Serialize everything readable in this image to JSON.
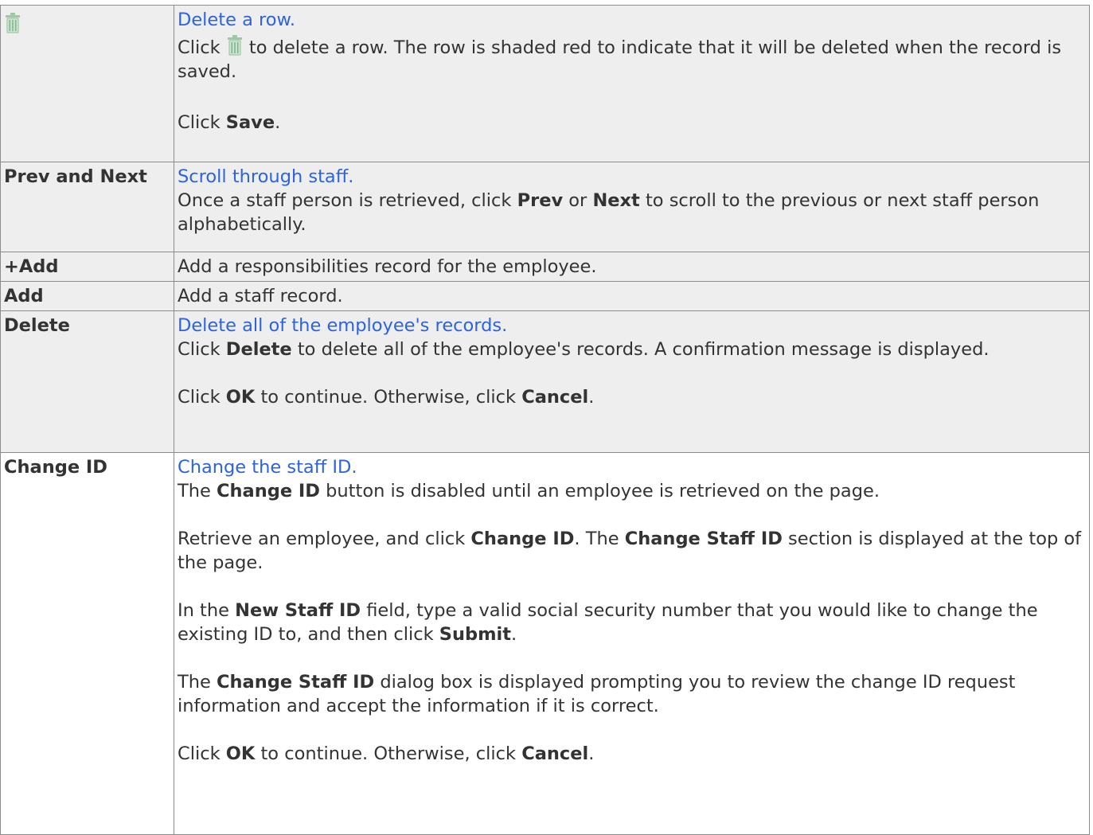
{
  "rows": [
    {
      "key_icon": "trash-icon",
      "heading": "Delete a row.",
      "p1": {
        "a": "Click ",
        "icon": "trash-icon",
        "b": " to delete a row. The row is shaded red to indicate that it will be deleted when the record is saved."
      },
      "p2": {
        "a": "Click ",
        "b": "Save",
        "c": "."
      }
    },
    {
      "key": "Prev and Next",
      "heading": "Scroll through staff.",
      "p1": {
        "a": "Once a staff person is retrieved, click ",
        "b": "Prev",
        "c": " or ",
        "d": "Next",
        "e": " to scroll to the previous or next staff person alphabetically."
      }
    },
    {
      "key": "+Add",
      "text": "Add a responsibilities record for the employee."
    },
    {
      "key": "Add",
      "text": "Add a staff record."
    },
    {
      "key": "Delete",
      "heading": "Delete all of the employee's records.",
      "p1": {
        "a": "Click ",
        "b": "Delete",
        "c": " to delete all of the employee's records. A confirmation message is displayed."
      },
      "p2": {
        "a": "Click ",
        "b": "OK",
        "c": " to continue. Otherwise, click ",
        "d": "Cancel",
        "e": "."
      }
    },
    {
      "key": "Change ID",
      "heading": "Change the staff ID.",
      "p1": {
        "a": "The ",
        "b": "Change ID",
        "c": " button is disabled until an employee is retrieved on the page."
      },
      "p2": {
        "a": "Retrieve an employee, and click ",
        "b": "Change ID",
        "c": ". The ",
        "d": "Change Staff ID",
        "e": " section is displayed at the top of the page."
      },
      "p3": {
        "a": "In the ",
        "b": "New Staff ID",
        "c": " field, type a valid social security number that you would like to change the existing ID to, and then click ",
        "d": "Submit",
        "e": "."
      },
      "p4": {
        "a": "The ",
        "b": "Change Staff ID",
        "c": " dialog box is displayed prompting you to review the change ID request information and accept the information if it is correct."
      },
      "p5": {
        "a": "Click ",
        "b": "OK",
        "c": " to continue. Otherwise, click ",
        "d": "Cancel",
        "e": "."
      }
    }
  ],
  "colors": {
    "link": "#2b63e0",
    "row_gray": "#eeeeee",
    "border": "#8c8c8c",
    "icon": "#9fc9a6"
  }
}
